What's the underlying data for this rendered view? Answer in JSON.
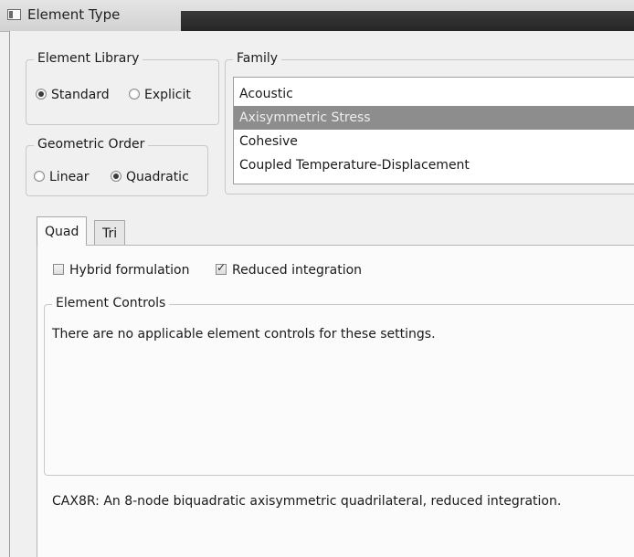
{
  "window": {
    "title": "Element Type",
    "icon": "window-icon"
  },
  "element_library": {
    "legend": "Element Library",
    "options": [
      {
        "label": "Standard",
        "selected": true
      },
      {
        "label": "Explicit",
        "selected": false
      }
    ]
  },
  "geometric_order": {
    "legend": "Geometric Order",
    "options": [
      {
        "label": "Linear",
        "selected": false
      },
      {
        "label": "Quadratic",
        "selected": true
      }
    ]
  },
  "family": {
    "legend": "Family",
    "items": [
      {
        "label": "Acoustic",
        "selected": false
      },
      {
        "label": "Axisymmetric Stress",
        "selected": true
      },
      {
        "label": "Cohesive",
        "selected": false
      },
      {
        "label": "Coupled Temperature-Displacement",
        "selected": false
      }
    ],
    "selected_color": "#8d8d8d"
  },
  "tabs": [
    {
      "label": "Quad",
      "active": true
    },
    {
      "label": "Tri",
      "active": false
    }
  ],
  "options": {
    "hybrid": {
      "label": "Hybrid formulation",
      "checked": false
    },
    "reduced": {
      "label": "Reduced integration",
      "checked": true
    }
  },
  "element_controls": {
    "legend": "Element Controls",
    "message": "There are no applicable element controls for these settings."
  },
  "description": "CAX8R:  An 8-node biquadratic axisymmetric quadrilateral, reduced integration."
}
